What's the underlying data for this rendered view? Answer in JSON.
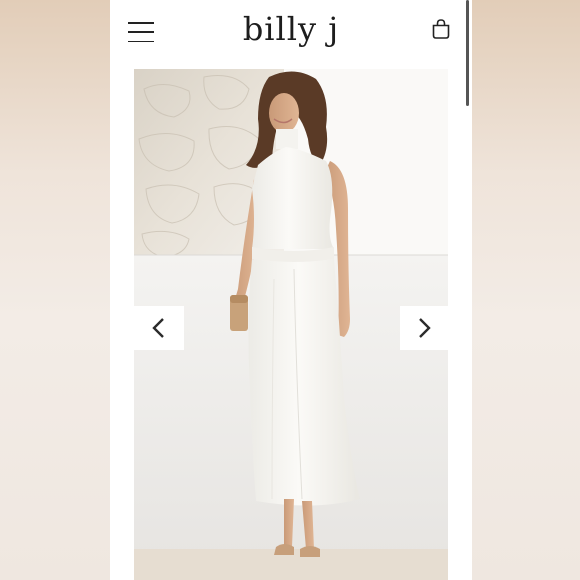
{
  "app": {
    "brand": "billy j"
  },
  "header": {
    "menu_icon": "hamburger-menu-icon",
    "cart_icon": "shopping-bag-icon"
  },
  "gallery": {
    "image_alt_icon": "product-photo",
    "prev_icon": "chevron-left-icon",
    "next_icon": "chevron-right-icon"
  },
  "colors": {
    "background": "#f3ece6",
    "page": "#ffffff",
    "text": "#1d1d1d",
    "dress": "#f7f6f2",
    "wall": "#ebeae8"
  }
}
